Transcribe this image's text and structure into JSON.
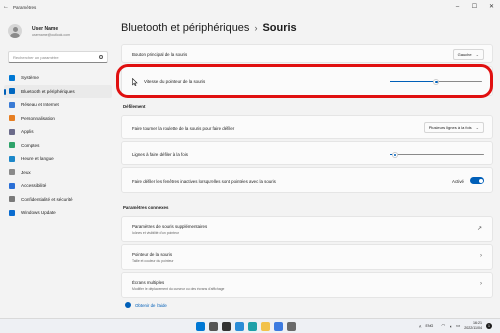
{
  "window": {
    "title": "Paramètres",
    "back_glyph": "←",
    "minimize_glyph": "–",
    "maximize_glyph": "☐",
    "close_glyph": "✕"
  },
  "sidebar": {
    "user": {
      "name": "User Name",
      "email": "username@outlook.com"
    },
    "search": {
      "placeholder": "Rechercher un paramètre"
    },
    "items": [
      {
        "label": "Système",
        "icon": "monitor-icon",
        "color": "#0078d4",
        "active": false
      },
      {
        "label": "Bluetooth et périphériques",
        "icon": "bluetooth-icon",
        "color": "#0067c0",
        "active": true
      },
      {
        "label": "Réseau et Internet",
        "icon": "wifi-icon",
        "color": "#3a7bd5",
        "active": false
      },
      {
        "label": "Personnalisation",
        "icon": "brush-icon",
        "color": "#e67e22",
        "active": false
      },
      {
        "label": "Applis",
        "icon": "apps-icon",
        "color": "#6b6b8a",
        "active": false
      },
      {
        "label": "Comptes",
        "icon": "account-icon",
        "color": "#2ea36a",
        "active": false
      },
      {
        "label": "Heure et langue",
        "icon": "globe-clock-icon",
        "color": "#1c87c9",
        "active": false
      },
      {
        "label": "Jeux",
        "icon": "gamepad-icon",
        "color": "#8a8a8a",
        "active": false
      },
      {
        "label": "Accessibilité",
        "icon": "accessibility-icon",
        "color": "#2a6fd6",
        "active": false
      },
      {
        "label": "Confidentialité et sécurité",
        "icon": "shield-icon",
        "color": "#7a7a7a",
        "active": false
      },
      {
        "label": "Windows Update",
        "icon": "update-icon",
        "color": "#0a6cd0",
        "active": false
      }
    ]
  },
  "main": {
    "breadcrumb": {
      "parent": "Bluetooth et périphériques",
      "separator": "›",
      "current": "Souris"
    },
    "primary_button": {
      "label": "Bouton principal de la souris",
      "value": "Gauche"
    },
    "pointer_speed": {
      "label": "Vitesse du pointeur de la souris",
      "value": 0.5
    },
    "scroll_section_title": "Défilement",
    "scroll_wheel": {
      "label": "Faire tourner la roulette de la souris pour faire défiler",
      "value": "Plusieurs lignes à la fois"
    },
    "lines_to_scroll": {
      "label": "Lignes à faire défiler à la fois",
      "value": 0.05
    },
    "inactive_scroll": {
      "label": "Faire défiler les fenêtres inactives lorsqu'elles sont pointées avec la souris",
      "state": "Activé"
    },
    "related_section_title": "Paramètres connexes",
    "related": [
      {
        "title": "Paramètres de souris supplémentaires",
        "subtitle": "Icônes et visibilité d'un pointeur",
        "arrow": "↗"
      },
      {
        "title": "Pointeur de la souris",
        "subtitle": "Taille et couleur du pointeur",
        "arrow": "›"
      },
      {
        "title": "Écrans multiples",
        "subtitle": "Modifier le déplacement du curseur ou des écrans d'affichage",
        "arrow": "›"
      }
    ],
    "help_link": "Obtenir de l'aide",
    "dropdown_glyph": "⌄"
  },
  "taskbar": {
    "apps": [
      {
        "icon": "start-icon",
        "color": "#0078d4"
      },
      {
        "icon": "search-icon",
        "color": "#555555"
      },
      {
        "icon": "task-view-icon",
        "color": "#333333"
      },
      {
        "icon": "widgets-icon",
        "color": "#2a8cd6"
      },
      {
        "icon": "edge-icon",
        "color": "#1fa0a8"
      },
      {
        "icon": "folder-icon",
        "color": "#f2c24b"
      },
      {
        "icon": "store-icon",
        "color": "#3d7be0"
      },
      {
        "icon": "settings-icon",
        "color": "#6a6a6a"
      }
    ],
    "language": "ENG",
    "time": "16:21",
    "date": "2022/11/04",
    "notification_count": "1"
  }
}
